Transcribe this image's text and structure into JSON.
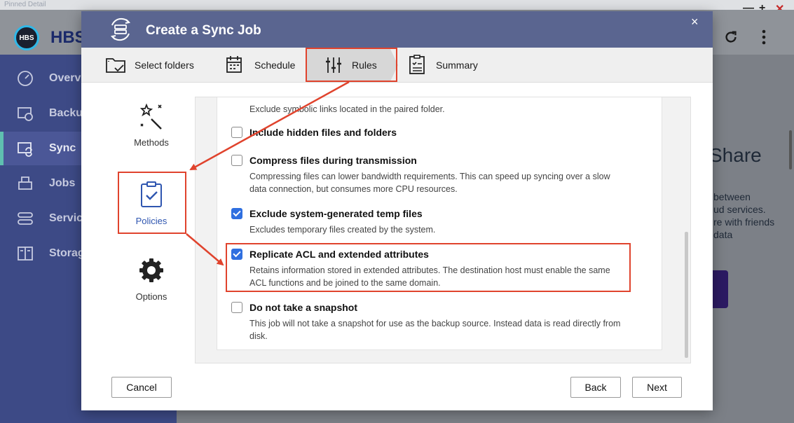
{
  "background": {
    "top_bar_title": "Pinned Detail",
    "app_title": "HBS",
    "logo_text": "HBS",
    "nav_items": [
      {
        "label": "Overvi",
        "icon": "gauge-icon",
        "active": false
      },
      {
        "label": "Backu",
        "icon": "backup-icon",
        "active": false
      },
      {
        "label": "Sync",
        "icon": "sync-icon",
        "active": true
      },
      {
        "label": "Jobs",
        "icon": "jobs-icon",
        "active": false
      },
      {
        "label": "Servic",
        "icon": "services-icon",
        "active": false
      },
      {
        "label": "Storag",
        "icon": "storage-icon",
        "active": false
      }
    ],
    "heading": "Share",
    "text_lines": [
      "between",
      "ud services.",
      "re with friends",
      "data"
    ],
    "window_controls": [
      "—",
      "+",
      "✕"
    ]
  },
  "dialog": {
    "title": "Create a Sync Job",
    "close_glyph": "×",
    "steps": [
      {
        "label": "Select folders",
        "icon": "folder-check-icon"
      },
      {
        "label": "Schedule",
        "icon": "calendar-icon"
      },
      {
        "label": "Rules",
        "icon": "sliders-icon",
        "active": true
      },
      {
        "label": "Summary",
        "icon": "clipboard-list-icon"
      }
    ],
    "side_tabs": [
      {
        "label": "Methods",
        "icon": "magic-wand-icon"
      },
      {
        "label": "Policies",
        "icon": "clipboard-check-icon",
        "active": true
      },
      {
        "label": "Options",
        "icon": "gear-icon"
      }
    ],
    "options": {
      "symlinks_desc": "Exclude symbolic links located in the paired folder.",
      "hidden": {
        "label": "Include hidden files and folders",
        "checked": false
      },
      "compress": {
        "label": "Compress files during transmission",
        "checked": false,
        "desc1": "Compressing files can lower bandwidth requirements. This can speed up syncing over a slow",
        "desc2": "data connection, but consumes more CPU resources."
      },
      "temp": {
        "label": "Exclude system-generated temp files",
        "checked": true,
        "desc1": "Excludes temporary files created by the system."
      },
      "acl": {
        "label": "Replicate ACL and extended attributes",
        "checked": true,
        "desc1": "Retains information stored in extended attributes. The destination host must enable the same",
        "desc2": "ACL functions and be joined to the same domain."
      },
      "snapshot": {
        "label": "Do not take a snapshot",
        "checked": false,
        "desc1": "This job will not take a snapshot for use as the backup source. Instead data is read directly from",
        "desc2": "disk."
      }
    },
    "buttons": {
      "cancel": "Cancel",
      "back": "Back",
      "next": "Next"
    }
  },
  "colors": {
    "accent": "#2f6fe0",
    "annotation": "#e0432d",
    "header": "#5a6590",
    "sidebar": "#3d4a86"
  }
}
